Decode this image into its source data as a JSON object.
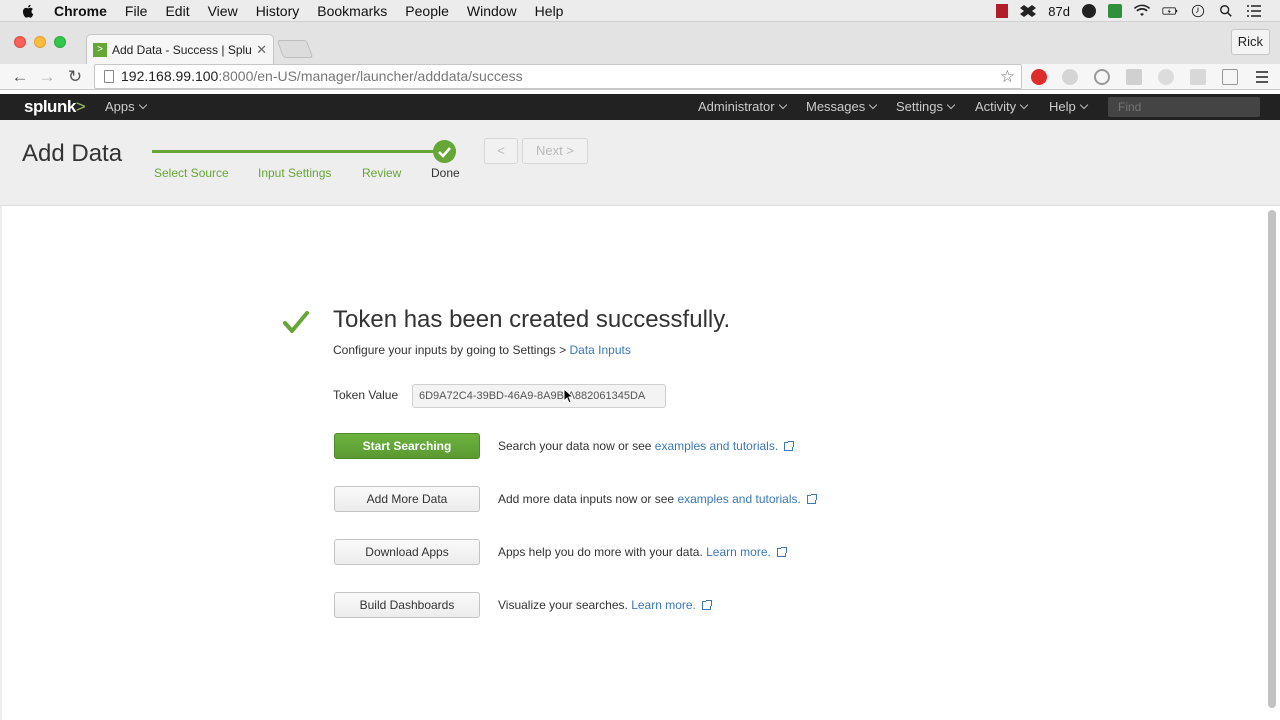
{
  "mac_menu": {
    "app": "Chrome",
    "items": [
      "File",
      "Edit",
      "View",
      "History",
      "Bookmarks",
      "People",
      "Window",
      "Help"
    ],
    "temperature": "87d"
  },
  "browser": {
    "tab_title": "Add Data - Success | Splunk",
    "profile": "Rick",
    "url_host": "192.168.99.100",
    "url_path": ":8000/en-US/manager/launcher/adddata/success"
  },
  "splunk_nav": {
    "logo": "splunk",
    "logo_suffix": ">",
    "apps": "Apps",
    "items": [
      "Administrator",
      "Messages",
      "Settings",
      "Activity",
      "Help"
    ],
    "find_placeholder": "Find"
  },
  "header": {
    "title": "Add Data",
    "steps": [
      "Select Source",
      "Input Settings",
      "Review",
      "Done"
    ],
    "prev": "<",
    "next": "Next >"
  },
  "success": {
    "title": "Token has been created successfully.",
    "configure_text": "Configure your inputs by going to Settings > ",
    "configure_link": "Data Inputs",
    "token_label": "Token Value",
    "token_value": "6D9A72C4-39BD-46A9-8A9B-A882061345DA"
  },
  "actions": [
    {
      "label": "Start Searching",
      "text": "Search your data now or see ",
      "link": "examples and tutorials."
    },
    {
      "label": "Add More Data",
      "text": "Add more data inputs now or see ",
      "link": "examples and tutorials."
    },
    {
      "label": "Download Apps",
      "text": "Apps help you do more with your data. ",
      "link": "Learn more."
    },
    {
      "label": "Build Dashboards",
      "text": "Visualize your searches. ",
      "link": "Learn more."
    }
  ],
  "colors": {
    "accent_green": "#65a637",
    "link_blue": "#3c78b5",
    "nav_bg": "#222222"
  }
}
